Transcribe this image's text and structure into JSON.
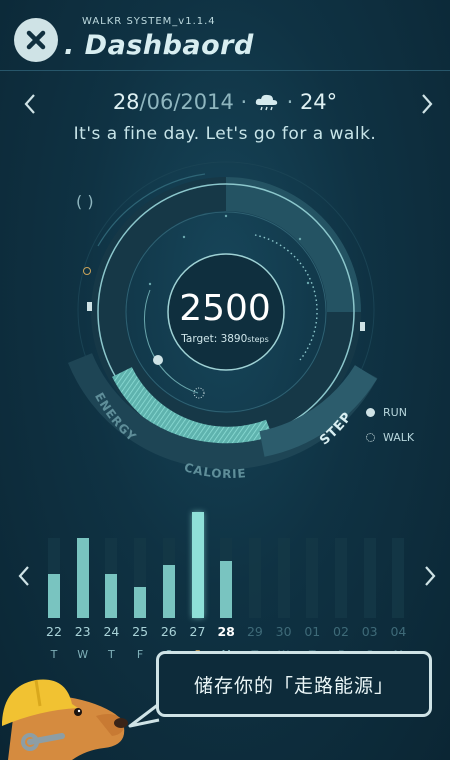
{
  "header": {
    "system_version": "WALKR SYSTEM_v1.1.4",
    "title": ". Dashbaord",
    "close_icon": "close-icon"
  },
  "date_row": {
    "date_main": "28",
    "date_rest": "/06/2014",
    "separator1": " · ",
    "weather_icon": "rain-cloud-icon",
    "separator2": " · ",
    "temperature": "24°"
  },
  "tagline": "It's a fine day.  Let's go for a walk.",
  "gauge": {
    "steps": "2500",
    "target_label": "Target: 3890",
    "target_unit": "steps",
    "segments": [
      "ENERGY",
      "CALORIE",
      "STEP"
    ],
    "progress_fraction": 0.64
  },
  "legend": {
    "run": "RUN",
    "walk": "WALK"
  },
  "colors": {
    "accent": "#7fd1cc",
    "accent_dim": "#5aa7a4",
    "track": "#1d3f4f",
    "highlight_day": "#ffffff"
  },
  "chart_data": {
    "type": "bar",
    "categories": [
      "22",
      "23",
      "24",
      "25",
      "26",
      "27",
      "28",
      "29",
      "30",
      "01",
      "02",
      "03",
      "04"
    ],
    "day_letters": [
      "T",
      "W",
      "T",
      "F",
      "S",
      "S",
      "M",
      "T",
      "W",
      "T",
      "F",
      "S",
      "M"
    ],
    "values": [
      0.5,
      0.9,
      0.5,
      0.35,
      0.6,
      1.2,
      0.65,
      0,
      0,
      0,
      0,
      0,
      0
    ],
    "max": 1.2,
    "highlight_index": 5,
    "today_index": 6,
    "future_from_index": 7
  },
  "mascot_bubble": {
    "text": "储存你的「走路能源」"
  }
}
